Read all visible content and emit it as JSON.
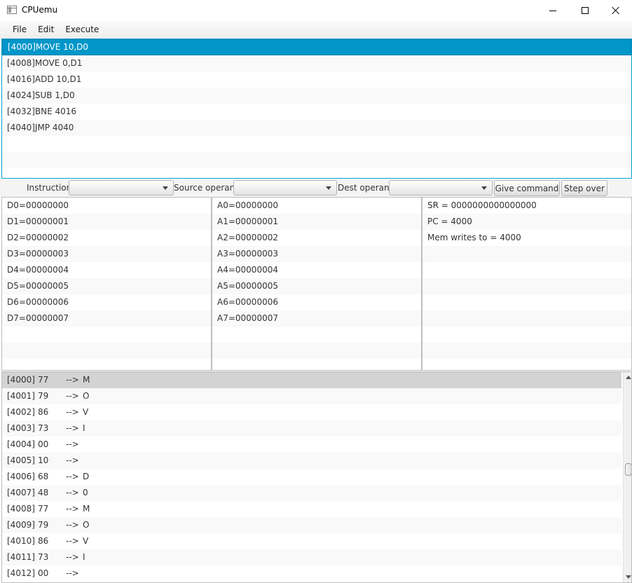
{
  "window": {
    "title": "CPUemu"
  },
  "menu": [
    {
      "label": "File"
    },
    {
      "label": "Edit"
    },
    {
      "label": "Execute"
    }
  ],
  "program": {
    "selected_index": 0,
    "rows": [
      "[4000]MOVE 10,D0",
      "[4008]MOVE 0,D1",
      "[4016]ADD 10,D1",
      "[4024]SUB 1,D0",
      "[4032]BNE 4016",
      "[4040]JMP 4040"
    ]
  },
  "toolbar": {
    "instruction_label": "Instruction:",
    "source_label": "Source operand",
    "dest_label": "Dest operand",
    "instruction_value": "",
    "source_value": "",
    "dest_value": "",
    "give_command": "Give command",
    "step_over": "Step over"
  },
  "data_registers": [
    "D0=00000000",
    "D1=00000001",
    "D2=00000002",
    "D3=00000003",
    "D4=00000004",
    "D5=00000005",
    "D6=00000006",
    "D7=00000007"
  ],
  "address_registers": [
    "A0=00000000",
    "A1=00000001",
    "A2=00000002",
    "A3=00000003",
    "A4=00000004",
    "A5=00000005",
    "A6=00000006",
    "A7=00000007"
  ],
  "status": [
    "SR = 0000000000000000",
    "PC = 4000",
    "Mem writes to = 4000"
  ],
  "memory": {
    "current_index": 0,
    "scroll_position": 0.46,
    "rows": [
      {
        "addr": "[4000]",
        "value": "77",
        "arrow": "-->",
        "char": "M"
      },
      {
        "addr": "[4001]",
        "value": "79",
        "arrow": "-->",
        "char": "O"
      },
      {
        "addr": "[4002]",
        "value": "86",
        "arrow": "-->",
        "char": "V"
      },
      {
        "addr": "[4003]",
        "value": "73",
        "arrow": "-->",
        "char": "I"
      },
      {
        "addr": "[4004]",
        "value": "00",
        "arrow": "-->",
        "char": ""
      },
      {
        "addr": "[4005]",
        "value": "10",
        "arrow": "-->",
        "char": ""
      },
      {
        "addr": "[4006]",
        "value": "68",
        "arrow": "-->",
        "char": "D"
      },
      {
        "addr": "[4007]",
        "value": "48",
        "arrow": "-->",
        "char": "0"
      },
      {
        "addr": "[4008]",
        "value": "77",
        "arrow": "-->",
        "char": "M"
      },
      {
        "addr": "[4009]",
        "value": "79",
        "arrow": "-->",
        "char": "O"
      },
      {
        "addr": "[4010]",
        "value": "86",
        "arrow": "-->",
        "char": "V"
      },
      {
        "addr": "[4011]",
        "value": "73",
        "arrow": "-->",
        "char": "I"
      },
      {
        "addr": "[4012]",
        "value": "00",
        "arrow": "-->",
        "char": ""
      }
    ]
  },
  "colors": {
    "selection": "#0096c9",
    "focus_border": "#039ed3",
    "current_memory_row": "#d3d3d3"
  }
}
